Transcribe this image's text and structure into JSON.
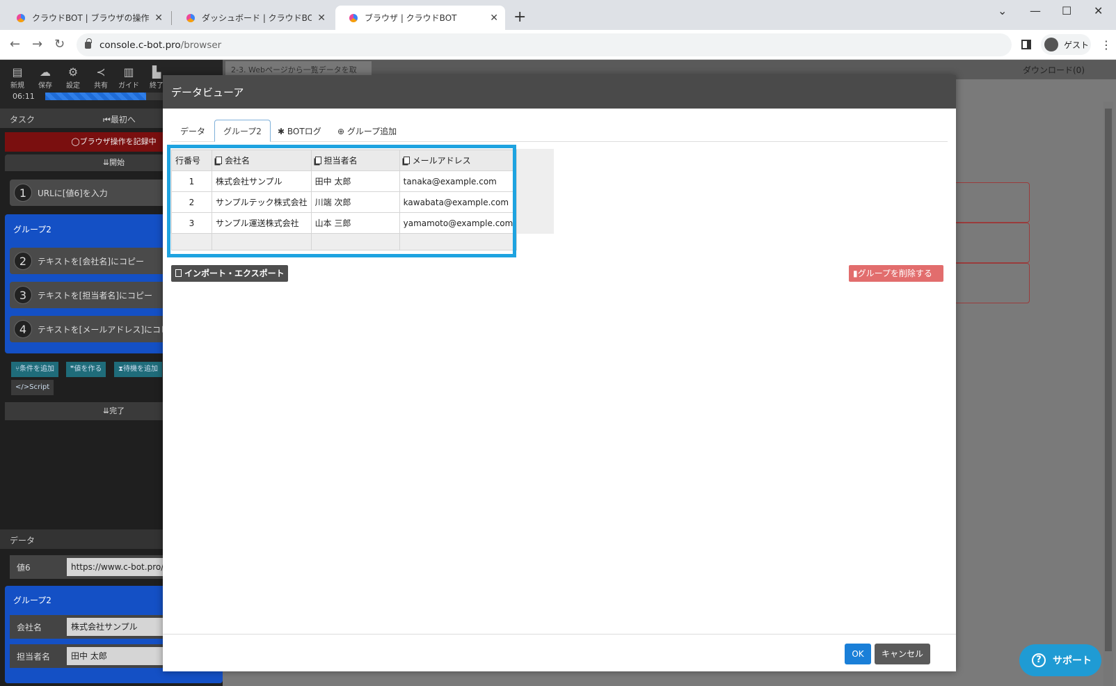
{
  "browser": {
    "tabs": [
      {
        "title": "クラウドBOT | ブラウザの操作を自動化"
      },
      {
        "title": "ダッシュボード | クラウドBOT"
      },
      {
        "title": "ブラウザ | クラウドBOT"
      }
    ],
    "url_host": "console.c-bot.pro",
    "url_path": "/browser",
    "profile_label": "ゲスト"
  },
  "left_panel": {
    "toolbar": [
      {
        "label": "新規",
        "icon": "file-icon"
      },
      {
        "label": "保存",
        "icon": "cloud-upload-icon"
      },
      {
        "label": "設定",
        "icon": "gear-icon"
      },
      {
        "label": "共有",
        "icon": "share-icon"
      },
      {
        "label": "ガイド",
        "icon": "book-icon"
      },
      {
        "label": "終了",
        "icon": "exit-icon"
      }
    ],
    "time": "06:11",
    "progress_fraction": 0.58,
    "task_label": "タスク",
    "first_label": "最初へ",
    "recording_label": "ブラウザ操作を記録中",
    "start_label": "開始",
    "steps": [
      {
        "num": "1",
        "label": "URLに[値6]を入力"
      },
      {
        "num": "2",
        "label": "テキストを[会社名]にコピー"
      },
      {
        "num": "3",
        "label": "テキストを[担当者名]にコピー"
      },
      {
        "num": "4",
        "label": "テキストを[メールアドレス]にコピー"
      }
    ],
    "group_title": "グループ2",
    "mini_buttons": [
      "条件を追加",
      "値を作る",
      "待機を追加",
      "Script"
    ],
    "done_label": "完了",
    "data_label": "データ",
    "data_rows": [
      {
        "key": "値6",
        "value": "https://www.c-bot.pro/"
      }
    ],
    "data_group_title": "グループ2",
    "data_group_rows": [
      {
        "key": "会社名",
        "value": "株式会社サンプル"
      },
      {
        "key": "担当者名",
        "value": "田中 太郎"
      }
    ]
  },
  "right_panel": {
    "tab_label": "2-3. Webページから一覧データを取",
    "download_label": "ダウンロード(0)"
  },
  "modal": {
    "title": "データビューア",
    "tabs": [
      "データ",
      "グループ2",
      "BOTログ",
      "グループ追加"
    ],
    "active_tab": "グループ2",
    "columns": [
      "行番号",
      "会社名",
      "担当者名",
      "メールアドレス"
    ],
    "rows": [
      [
        "1",
        "株式会社サンプル",
        "田中 太郎",
        "tanaka@example.com"
      ],
      [
        "2",
        "サンプルテック株式会社",
        "川端 次郎",
        "kawabata@example.com"
      ],
      [
        "3",
        "サンプル運送株式会社",
        "山本 三郎",
        "yamamoto@example.com"
      ]
    ],
    "import_export_label": "インポート・エクスポート",
    "delete_group_label": "グループを削除する",
    "ok_label": "OK",
    "cancel_label": "キャンセル"
  },
  "support_label": "サポート",
  "colors": {
    "highlight": "#1ea3e0",
    "group_blue": "#1450c5",
    "ok_blue": "#1a7fd8",
    "delete_red": "#e26d6d"
  }
}
